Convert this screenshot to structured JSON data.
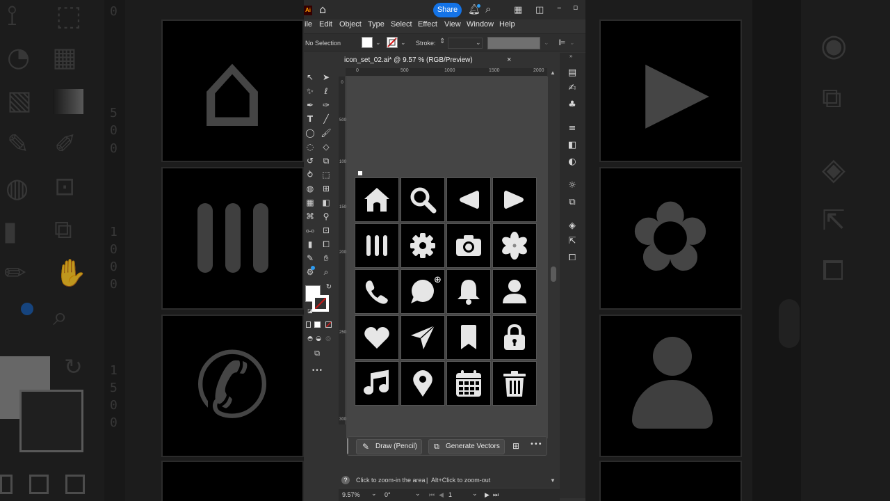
{
  "app": {
    "logo_text": "Ai",
    "share_label": "Share",
    "menu": [
      "ile",
      "Edit",
      "Object",
      "Type",
      "Select",
      "Effect",
      "View",
      "Window",
      "Help"
    ]
  },
  "control_bar": {
    "selection_text": "No Selection",
    "stroke_label": "Stroke:"
  },
  "document": {
    "title": "icon_set_02.ai* @ 9.57 % (RGB/Preview)",
    "close_glyph": "×"
  },
  "ruler": {
    "h_ticks": [
      "0",
      "500",
      "1000",
      "1500",
      "2000"
    ],
    "v_ticks": [
      "0",
      "500",
      "1000",
      "1500",
      "2000",
      "2500",
      "3000"
    ]
  },
  "icons": [
    "home-icon",
    "search-icon",
    "play-back-icon",
    "play-icon",
    "pause-bars-icon",
    "gear-icon",
    "camera-icon",
    "flower-icon",
    "phone-icon",
    "chat-bubble-icon",
    "bell-icon",
    "user-icon",
    "heart-icon",
    "send-icon",
    "bookmark-icon",
    "lock-icon",
    "music-note-icon",
    "location-pin-icon",
    "calendar-icon",
    "trash-icon"
  ],
  "taskbar": {
    "draw_label": "Draw (Pencil)",
    "generate_label": "Generate Vectors",
    "more_glyph": "•••"
  },
  "hint": {
    "help_glyph": "?",
    "text_a": "Click to zoom-in the area",
    "separator": "|",
    "text_b": "Alt+Click to zoom-out"
  },
  "status": {
    "zoom": "9.57%",
    "rotation": "0°",
    "artboard": "1"
  },
  "background": {
    "left_ruler_digits": [
      "0",
      "5",
      "0",
      "0",
      "1",
      "0",
      "0",
      "0",
      "1",
      "5",
      "0",
      "0"
    ]
  },
  "colors": {
    "accent": "#1473e6",
    "ai_orange": "#ff9a00",
    "canvas": "#454545",
    "panel": "#323232"
  }
}
